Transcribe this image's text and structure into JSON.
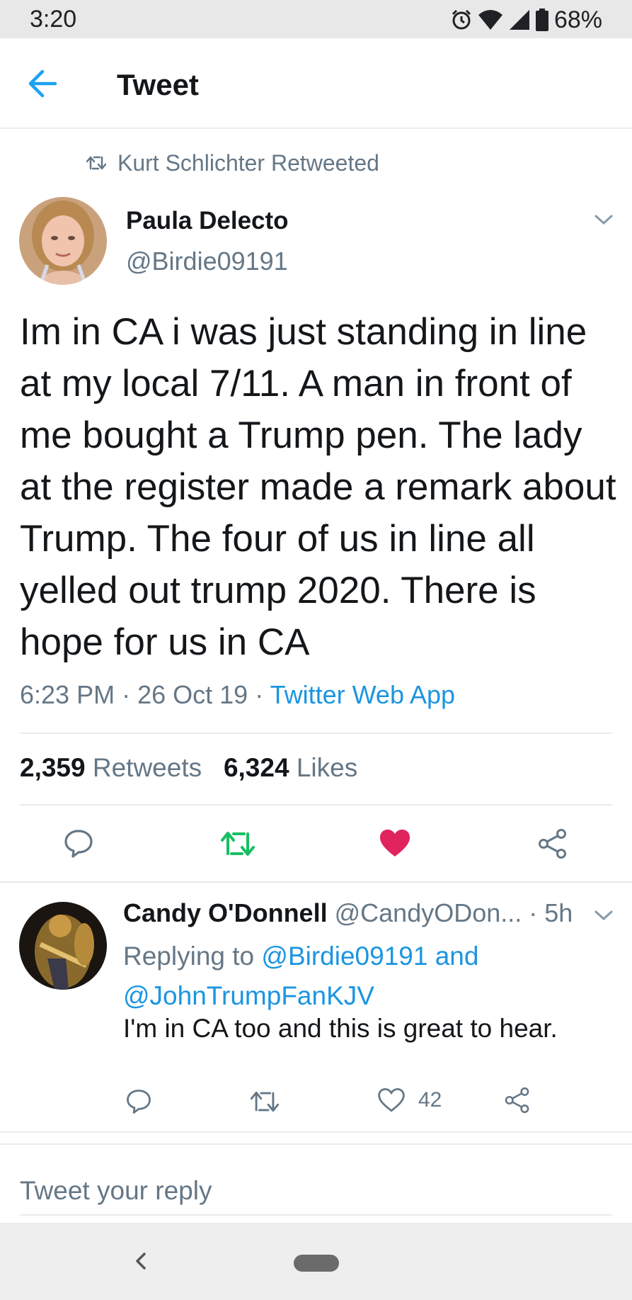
{
  "status_bar": {
    "time": "3:20",
    "battery": "68%",
    "icons": [
      "alarm-icon",
      "wifi-icon",
      "signal-icon",
      "battery-icon"
    ]
  },
  "header": {
    "title": "Tweet",
    "back_icon": "arrow-left-icon"
  },
  "retweet_context": {
    "icon": "retweet-icon",
    "text": "Kurt Schlichter Retweeted"
  },
  "tweet": {
    "author": {
      "name": "Paula Delecto",
      "handle": "@Birdie09191"
    },
    "text": "Im in CA i was just standing in line at my local 7/11. A man in front of me bought a Trump pen. The lady at the register made a remark about Trump. The four of us in line all yelled out trump 2020. There is hope for us in CA",
    "time": "6:23 PM",
    "date": "26 Oct 19",
    "separator": "·",
    "source": "Twitter Web App",
    "retweets": "2,359",
    "retweets_label": "Retweets",
    "likes": "6,324",
    "likes_label": "Likes",
    "liked": true,
    "colors": {
      "retweet_active": "#17bf63",
      "like_active": "#e0245e",
      "link": "#1b95e0",
      "muted": "#657786"
    }
  },
  "reply": {
    "name": "Candy O'Donnell",
    "handle": "@CandyODon...",
    "age": "· 5h",
    "replying_prefix": "Replying to",
    "replying_to_1": "@Birdie09191",
    "replying_and": "and",
    "replying_to_2": "@JohnTrumpFanKJV",
    "text": "I'm in CA too and this is great to hear.",
    "like_count": "42"
  },
  "compose": {
    "placeholder": "Tweet your reply"
  }
}
